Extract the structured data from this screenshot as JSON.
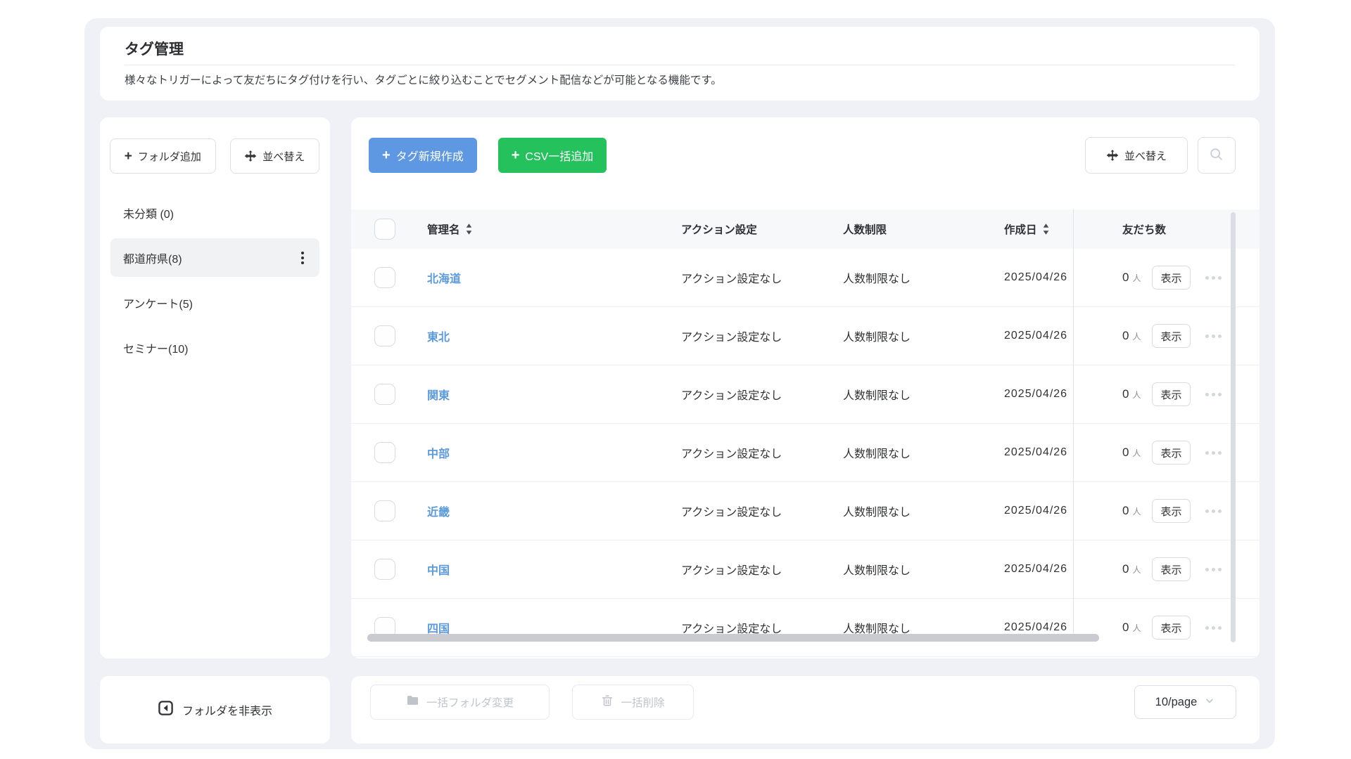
{
  "colors": {
    "primary_blue": "#5f98e2",
    "success_green": "#25c15c",
    "link_blue": "#5b9bdc",
    "app_background": "#eff1f6",
    "table_header_bg": "#f7f8fa"
  },
  "icons": {
    "add": "plus",
    "reorder": "move-arrows",
    "search": "magnifier",
    "folder_menu": "kebab-vertical-dots",
    "row_more": "ellipsis-horizontal-dots",
    "bulk_folder": "folder",
    "bulk_delete": "trash",
    "hide_folders": "collapse-left-square",
    "per_page": "chevron-down",
    "sort_column": "caret-up-down"
  },
  "page": {
    "title": "タグ管理",
    "description": "様々なトリガーによって友だちにタグ付けを行い、タグごとに絞り込むことでセグメント配信などが可能となる機能です。"
  },
  "sidebar": {
    "add_folder_label": "フォルダ追加",
    "sort_label": "並べ替え",
    "folders": [
      {
        "label": "未分類 (0)",
        "selected": false
      },
      {
        "label": "都道府県(8)",
        "selected": true
      },
      {
        "label": "アンケート(5)",
        "selected": false
      },
      {
        "label": "セミナー(10)",
        "selected": false
      }
    ],
    "hide_folders_label": "フォルダを非表示"
  },
  "toolbar": {
    "new_tag_label": "タグ新規作成",
    "csv_bulk_label": "CSV一括追加",
    "sort_label": "並べ替え"
  },
  "table": {
    "headers": {
      "name": "管理名",
      "action": "アクション設定",
      "limit": "人数制限",
      "date": "作成日",
      "friends": "友だち数"
    },
    "rows": [
      {
        "name": "北海道",
        "action": "アクション設定なし",
        "limit": "人数制限なし",
        "date": "2025/04/26",
        "count": "0",
        "count_unit": "人",
        "show_label": "表示"
      },
      {
        "name": "東北",
        "action": "アクション設定なし",
        "limit": "人数制限なし",
        "date": "2025/04/26",
        "count": "0",
        "count_unit": "人",
        "show_label": "表示"
      },
      {
        "name": "関東",
        "action": "アクション設定なし",
        "limit": "人数制限なし",
        "date": "2025/04/26",
        "count": "0",
        "count_unit": "人",
        "show_label": "表示"
      },
      {
        "name": "中部",
        "action": "アクション設定なし",
        "limit": "人数制限なし",
        "date": "2025/04/26",
        "count": "0",
        "count_unit": "人",
        "show_label": "表示"
      },
      {
        "name": "近畿",
        "action": "アクション設定なし",
        "limit": "人数制限なし",
        "date": "2025/04/26",
        "count": "0",
        "count_unit": "人",
        "show_label": "表示"
      },
      {
        "name": "中国",
        "action": "アクション設定なし",
        "limit": "人数制限なし",
        "date": "2025/04/26",
        "count": "0",
        "count_unit": "人",
        "show_label": "表示"
      },
      {
        "name": "四国",
        "action": "アクション設定なし",
        "limit": "人数制限なし",
        "date": "2025/04/26",
        "count": "0",
        "count_unit": "人",
        "show_label": "表示"
      }
    ]
  },
  "footer": {
    "bulk_folder_label": "一括フォルダ変更",
    "bulk_delete_label": "一括削除",
    "per_page": "10/page"
  }
}
